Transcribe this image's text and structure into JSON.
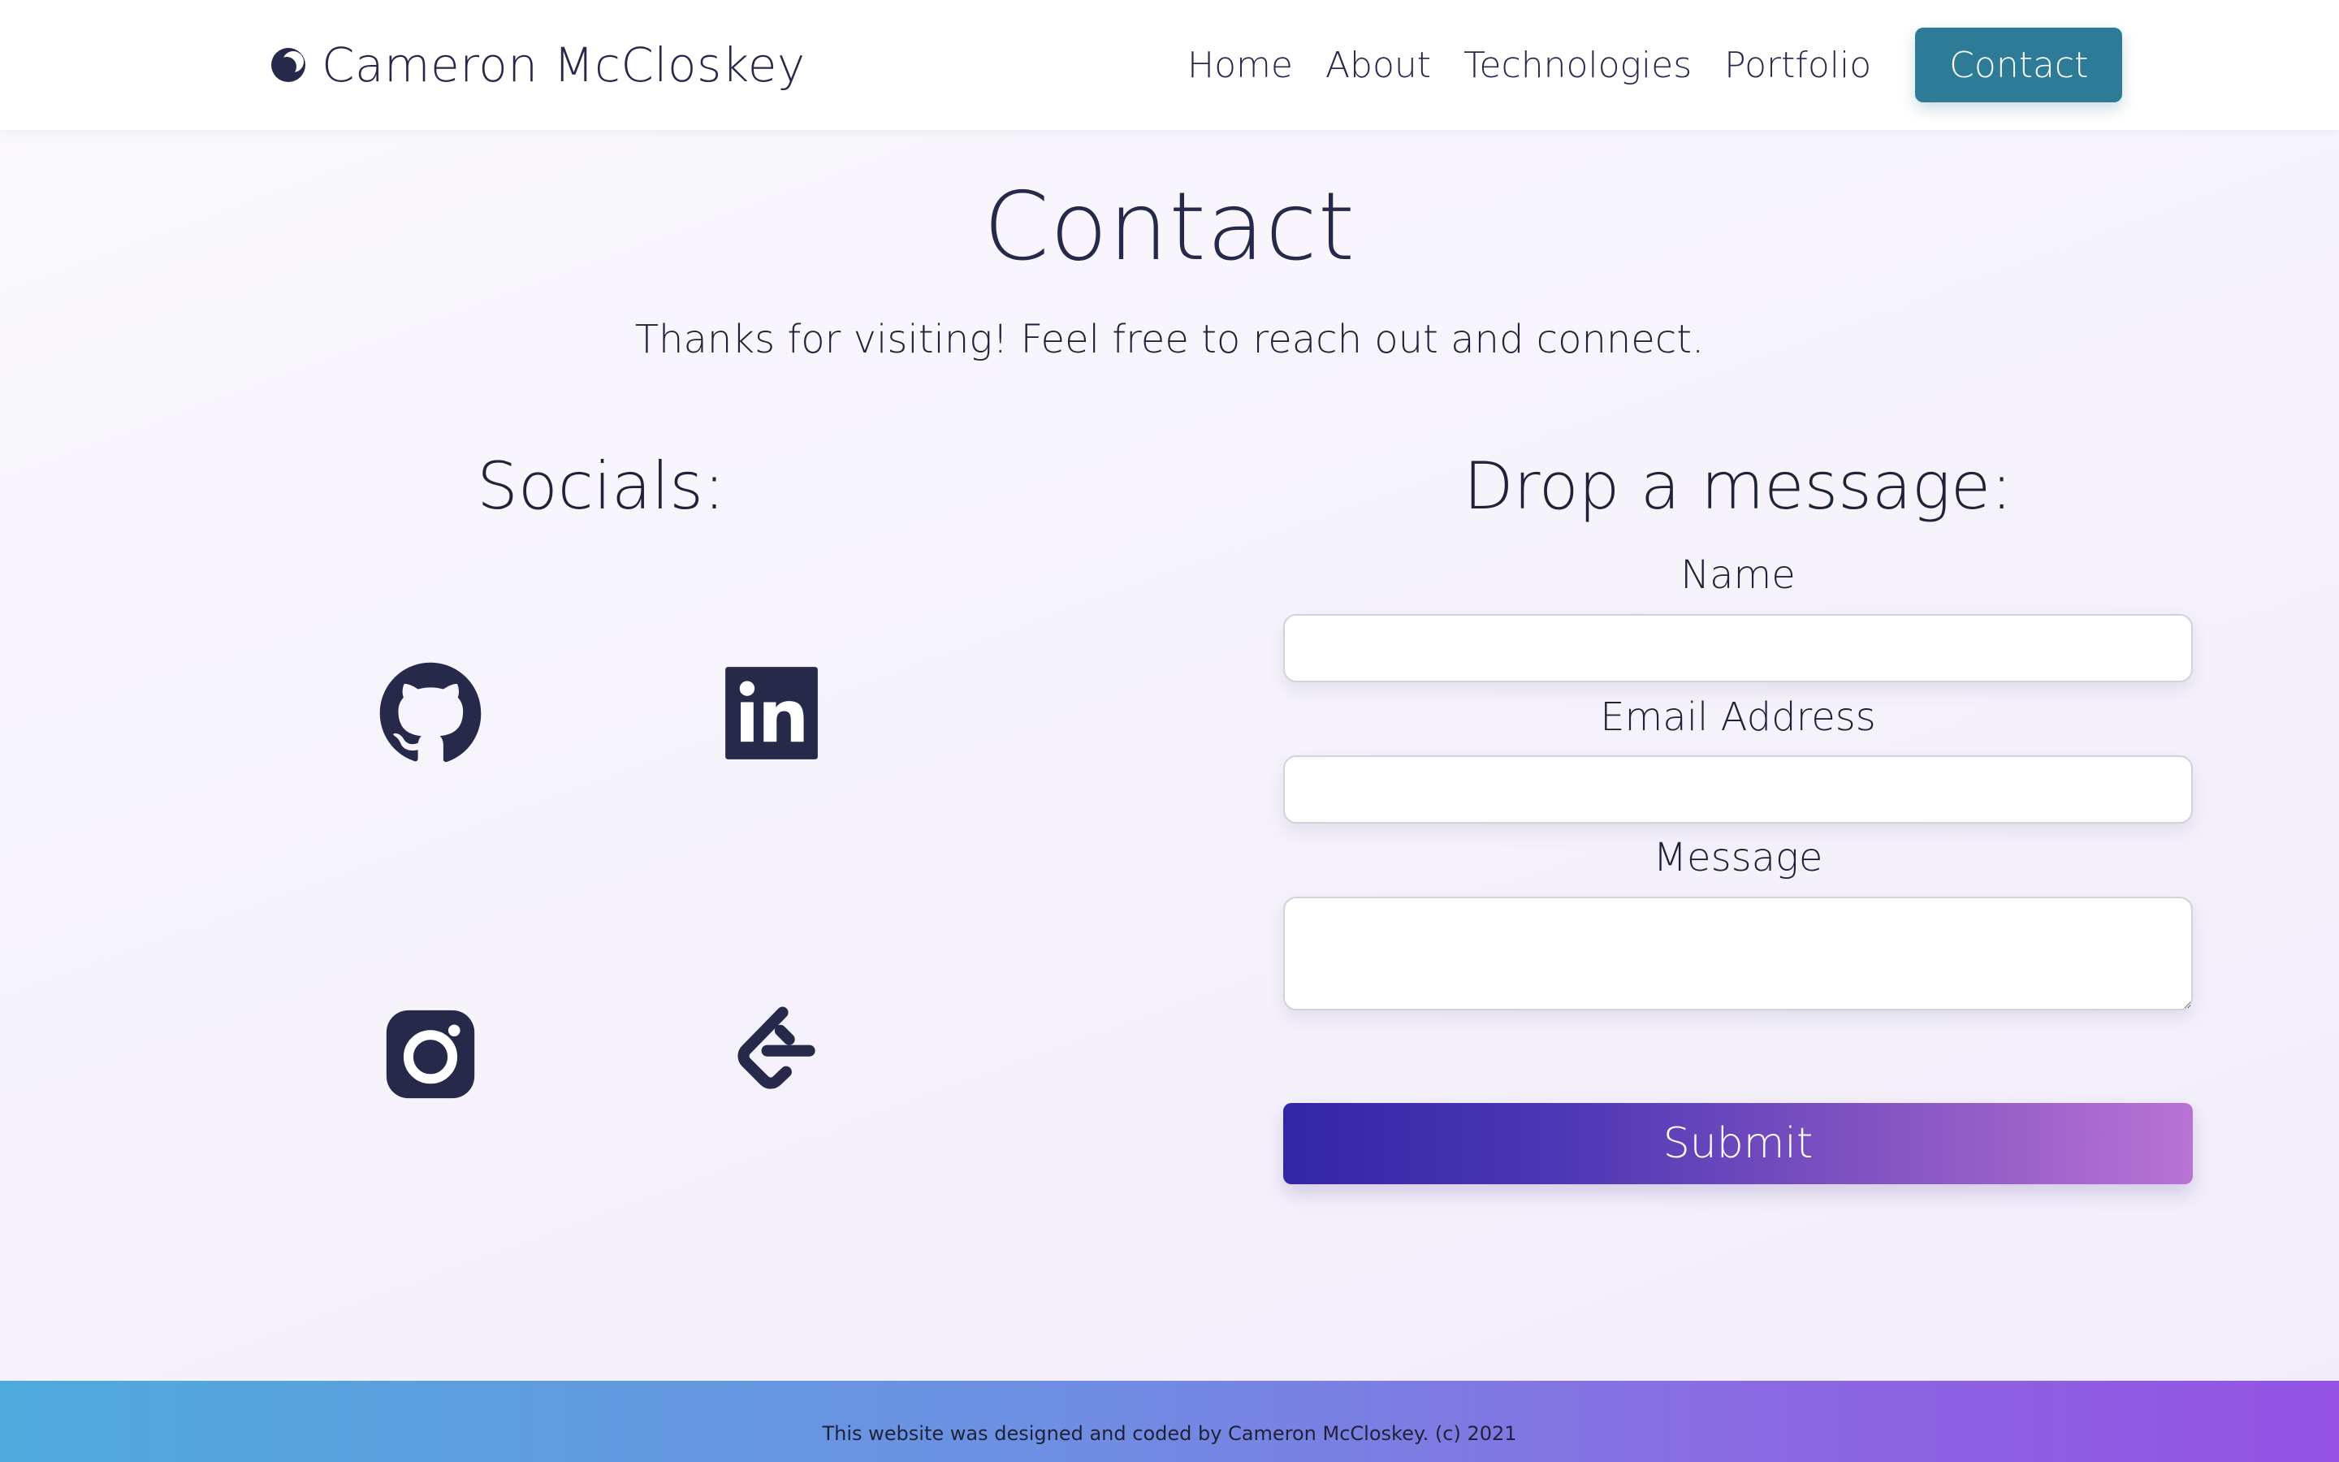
{
  "navbar": {
    "brand_name": "Cameron McCloskey",
    "brand_icon": "crescent-logo-icon",
    "links": [
      "Home",
      "About",
      "Technologies",
      "Portfolio"
    ],
    "cta_label": "Contact"
  },
  "header": {
    "title": "Contact",
    "subtitle": "Thanks for visiting! Feel free to reach out and connect."
  },
  "socials": {
    "heading": "Socials:",
    "icons": [
      "github-icon",
      "linkedin-icon",
      "instagram-icon",
      "leetcode-icon"
    ]
  },
  "form": {
    "heading": "Drop a message:",
    "name_label": "Name",
    "email_label": "Email Address",
    "message_label": "Message",
    "name_value": "",
    "email_value": "",
    "message_value": "",
    "submit_label": "Submit"
  },
  "footer": {
    "text": "This website was designed and coded by Cameron McCloskey. (c) 2021"
  },
  "colors": {
    "ink": "#26294a",
    "cta": "#2e7b98",
    "submit_start": "#3325a6",
    "submit_end": "#b973d4",
    "footer_start": "#4faadc",
    "footer_end": "#9352e3"
  }
}
